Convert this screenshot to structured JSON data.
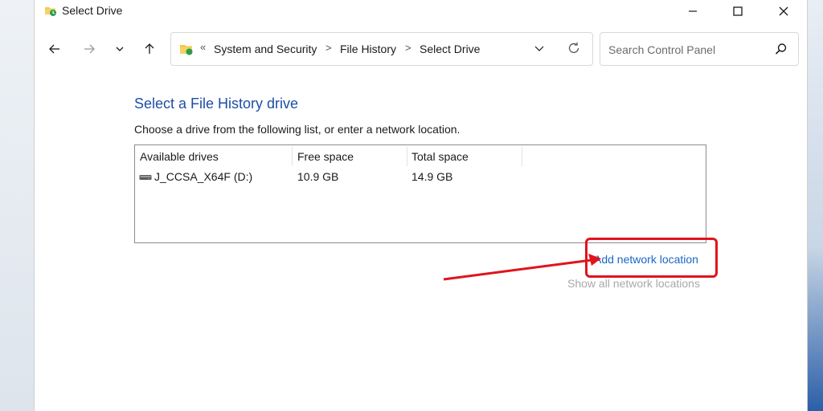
{
  "window": {
    "title": "Select Drive"
  },
  "address_bar": {
    "lead_separator": "«",
    "crumbs": [
      "System and Security",
      "File History",
      "Select Drive"
    ],
    "separator": ">"
  },
  "search": {
    "placeholder": "Search Control Panel"
  },
  "content": {
    "heading": "Select a File History drive",
    "instruction": "Choose a drive from the following list, or enter a network location.",
    "columns": [
      "Available drives",
      "Free space",
      "Total space"
    ],
    "drives": [
      {
        "name": "J_CCSA_X64F (D:)",
        "free": "10.9 GB",
        "total": "14.9 GB"
      }
    ],
    "add_network_link": "Add network location",
    "show_network_link": "Show all network locations"
  },
  "icons": {
    "title": "file-history-icon",
    "back": "back-arrow-icon",
    "forward": "forward-arrow-icon",
    "recent": "chevron-down-icon",
    "up": "up-arrow-icon",
    "refresh": "refresh-icon",
    "search": "search-icon",
    "drive": "usb-drive-icon"
  },
  "colors": {
    "heading": "#1e4fa5",
    "link": "#1a66c8",
    "disabled_link": "#a9a9a9",
    "annotation": "#e0141c"
  }
}
